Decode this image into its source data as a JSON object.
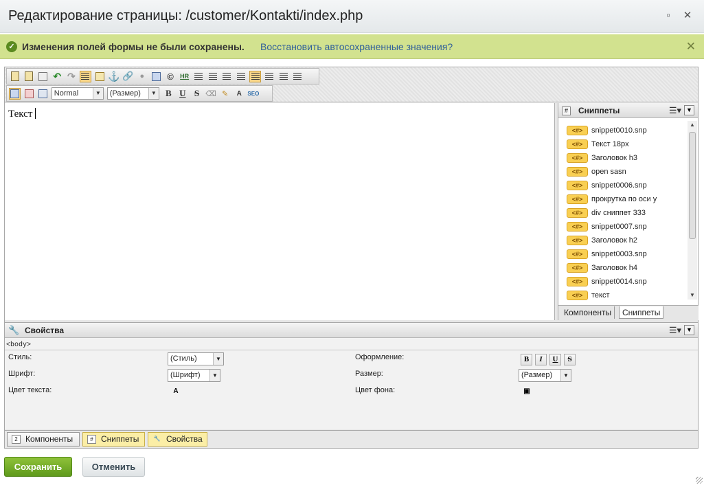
{
  "window": {
    "title": "Редактирование страницы: /customer/Kontakti/index.php"
  },
  "notice": {
    "message": "Изменения полей формы не были сохранены.",
    "restore_link": "Восстановить автосохраненные значения?"
  },
  "toolbar": {
    "style_select": "Normal",
    "size_select": "(Размер)",
    "bold": "B",
    "underline": "U",
    "strike": "S",
    "hr": "HR",
    "copyright": "©"
  },
  "editor": {
    "content": "Текст"
  },
  "snippets_panel": {
    "title": "Сниппеты",
    "badge": "<#>",
    "items": [
      "snippet0010.snp",
      "Текст 18px",
      "Заголовок h3",
      "open sasn",
      "snippet0006.snp",
      "прокрутка по оси y",
      "div сниппет 333",
      "snippet0007.snp",
      "Заголовок h2",
      "snippet0003.snp",
      "Заголовок h4",
      "snippet0014.snp",
      "текст"
    ],
    "tabs": [
      "Компоненты",
      "Сниппеты"
    ]
  },
  "properties": {
    "title": "Свойства",
    "tag": "<body>",
    "style_label": "Стиль:",
    "style_value": "(Стиль)",
    "font_label": "Шрифт:",
    "font_value": "(Шрифт)",
    "text_color_label": "Цвет текста:",
    "decoration_label": "Оформление:",
    "size_label": "Размер:",
    "size_value": "(Размер)",
    "bg_color_label": "Цвет фона:",
    "fmt_bold": "B",
    "fmt_italic": "I",
    "fmt_underline": "U",
    "fmt_strike": "S"
  },
  "bottom_tabs": [
    "Компоненты",
    "Сниппеты",
    "Свойства"
  ],
  "buttons": {
    "save": "Сохранить",
    "cancel": "Отменить"
  },
  "colors": {
    "accent_green": "#6aa424",
    "notice_bg": "#d2e28f",
    "link": "#2f5f9a",
    "snippet_badge": "#f9cf52"
  }
}
